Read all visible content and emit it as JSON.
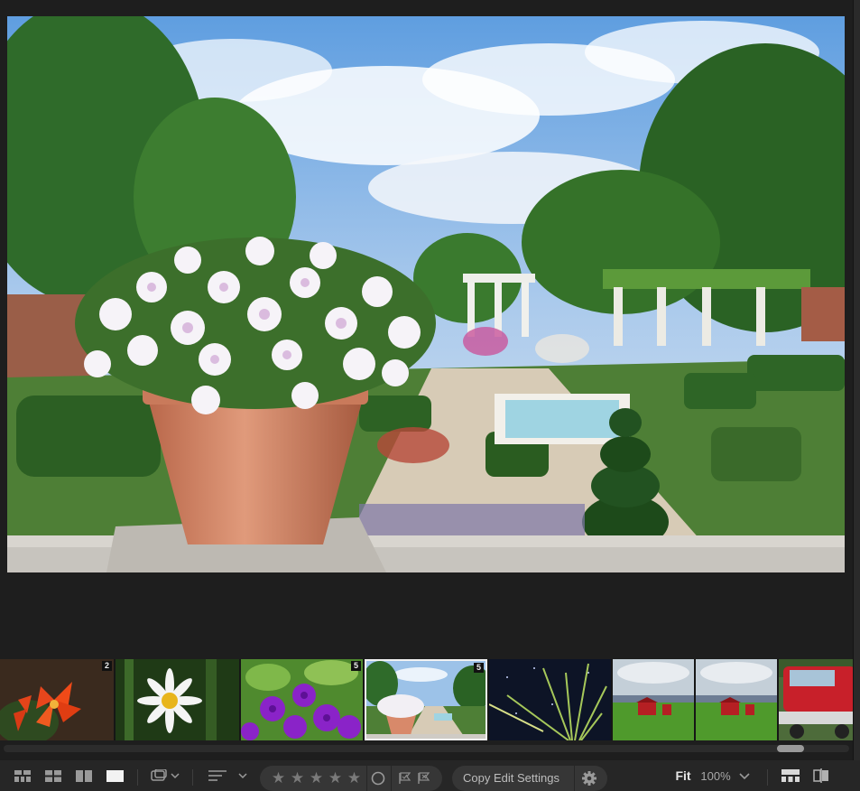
{
  "filmstrip": {
    "thumbnails": [
      {
        "name": "orange-lilies",
        "badge": "2",
        "selected": false
      },
      {
        "name": "white-daisy",
        "badge": "",
        "selected": false
      },
      {
        "name": "purple-petunias",
        "badge": "5",
        "selected": false
      },
      {
        "name": "garden-flower-pot",
        "badge": "5",
        "selected": true
      },
      {
        "name": "grass-stars",
        "badge": "",
        "selected": false
      },
      {
        "name": "red-barn-1",
        "badge": "",
        "selected": false
      },
      {
        "name": "red-barn-2",
        "badge": "",
        "selected": false
      },
      {
        "name": "red-truck",
        "badge": "",
        "selected": false
      }
    ]
  },
  "toolbar": {
    "grid_view_icon": "grid-small-icon",
    "square_grid_icon": "grid-square-icon",
    "compare_icon": "compare-view-icon",
    "loupe_icon": "loupe-view-icon",
    "stars": [
      "★",
      "★",
      "★",
      "★",
      "★"
    ],
    "copy_edit_settings": "Copy Edit Settings",
    "fit_label": "Fit",
    "zoom_level": "100%"
  },
  "colors": {
    "background": "#1e1e1e",
    "toolbar": "#262626",
    "pill": "#363636",
    "selected_border": "#f2f2f2"
  }
}
